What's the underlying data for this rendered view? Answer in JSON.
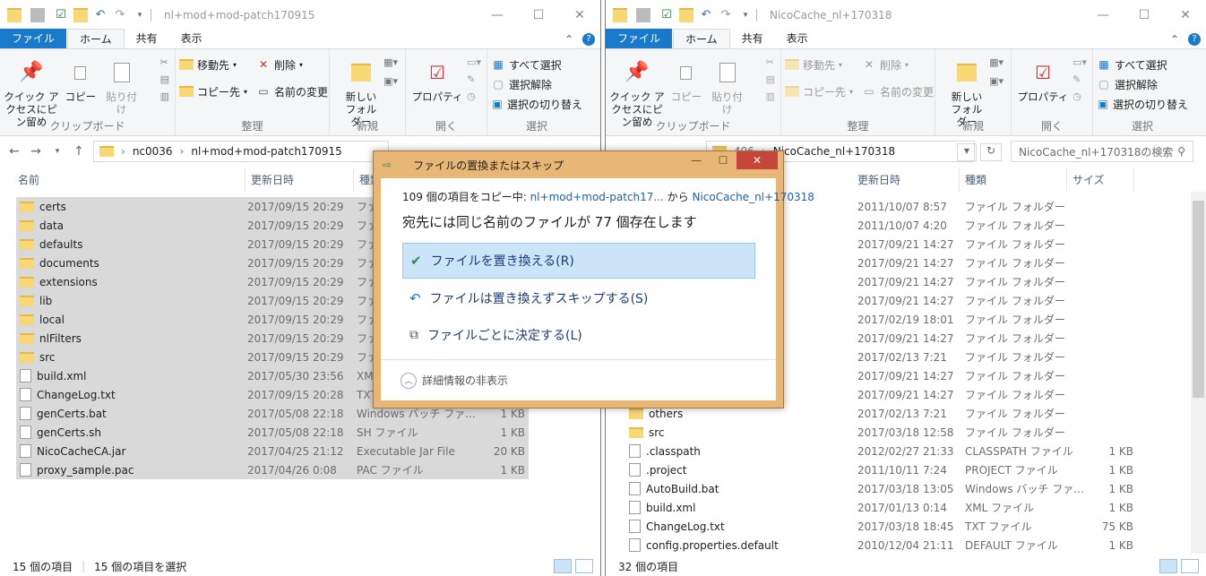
{
  "left": {
    "title": "nl+mod+mod-patch170915",
    "tabs": [
      "ファイル",
      "ホーム",
      "共有",
      "表示"
    ],
    "ribbon": {
      "pin": "クイック アクセスにピン留め",
      "copy": "コピー",
      "paste": "貼り付け",
      "clipboard": "クリップボード",
      "move_to": "移動先",
      "copy_to": "コピー先",
      "delete": "削除",
      "rename": "名前の変更",
      "organize": "整理",
      "new_folder": "新しいフォルダー",
      "new": "新規",
      "properties": "プロパティ",
      "open": "開く",
      "select_all": "すべて選択",
      "select_none": "選択解除",
      "invert": "選択の切り替え",
      "select": "選択"
    },
    "address": [
      "nc0036",
      "nl+mod+mod-patch170915"
    ],
    "columns": [
      "名前",
      "更新日時",
      "種類"
    ],
    "files": [
      {
        "name": "certs",
        "date": "2017/09/15 20:29",
        "type": "ファ",
        "size": "",
        "kind": "folder"
      },
      {
        "name": "data",
        "date": "2017/09/15 20:29",
        "type": "ファ",
        "size": "",
        "kind": "folder"
      },
      {
        "name": "defaults",
        "date": "2017/09/15 20:29",
        "type": "ファ",
        "size": "",
        "kind": "folder"
      },
      {
        "name": "documents",
        "date": "2017/09/15 20:29",
        "type": "ファ",
        "size": "",
        "kind": "folder"
      },
      {
        "name": "extensions",
        "date": "2017/09/15 20:29",
        "type": "ファ",
        "size": "",
        "kind": "folder"
      },
      {
        "name": "lib",
        "date": "2017/09/15 20:29",
        "type": "ファ",
        "size": "",
        "kind": "folder"
      },
      {
        "name": "local",
        "date": "2017/09/15 20:29",
        "type": "ファ",
        "size": "",
        "kind": "folder"
      },
      {
        "name": "nlFilters",
        "date": "2017/09/15 20:29",
        "type": "ファ",
        "size": "",
        "kind": "folder"
      },
      {
        "name": "src",
        "date": "2017/09/15 20:29",
        "type": "ファ",
        "size": "",
        "kind": "folder"
      },
      {
        "name": "build.xml",
        "date": "2017/05/30 23:56",
        "type": "XM",
        "size": "",
        "kind": "file"
      },
      {
        "name": "ChangeLog.txt",
        "date": "2017/09/15 20:28",
        "type": "TXT",
        "size": "",
        "kind": "file"
      },
      {
        "name": "genCerts.bat",
        "date": "2017/05/08 22:18",
        "type": "Windows バッチ ファ...",
        "size": "1 KB",
        "kind": "file"
      },
      {
        "name": "genCerts.sh",
        "date": "2017/05/08 22:18",
        "type": "SH ファイル",
        "size": "1 KB",
        "kind": "file"
      },
      {
        "name": "NicoCacheCA.jar",
        "date": "2017/04/25 21:12",
        "type": "Executable Jar File",
        "size": "20 KB",
        "kind": "file"
      },
      {
        "name": "proxy_sample.pac",
        "date": "2017/04/26 0:08",
        "type": "PAC ファイル",
        "size": "1 KB",
        "kind": "file"
      }
    ],
    "status_count": "15 個の項目",
    "status_selected": "15 個の項目を選択"
  },
  "right": {
    "title": "NicoCache_nl+170318",
    "tabs": [
      "ファイル",
      "ホーム",
      "共有",
      "表示"
    ],
    "address_prefix": "496",
    "address_current": "NicoCache_nl+170318",
    "search_placeholder": "NicoCache_nl+170318の検索",
    "columns": [
      "更新日時",
      "種類",
      "サイズ"
    ],
    "files": [
      {
        "name": "",
        "date": "2011/10/07 8:57",
        "type": "ファイル フォルダー",
        "size": "",
        "kind": "folder"
      },
      {
        "name": "",
        "date": "2011/10/07 4:20",
        "type": "ファイル フォルダー",
        "size": "",
        "kind": "folder"
      },
      {
        "name": "",
        "date": "2017/09/21 14:27",
        "type": "ファイル フォルダー",
        "size": "",
        "kind": "folder"
      },
      {
        "name": "",
        "date": "2017/09/21 14:27",
        "type": "ファイル フォルダー",
        "size": "",
        "kind": "folder"
      },
      {
        "name": "",
        "date": "2017/09/21 14:27",
        "type": "ファイル フォルダー",
        "size": "",
        "kind": "folder"
      },
      {
        "name": "",
        "date": "2017/09/21 14:27",
        "type": "ファイル フォルダー",
        "size": "",
        "kind": "folder"
      },
      {
        "name": "",
        "date": "2017/02/19 18:01",
        "type": "ファイル フォルダー",
        "size": "",
        "kind": "folder"
      },
      {
        "name": "",
        "date": "2017/09/21 14:27",
        "type": "ファイル フォルダー",
        "size": "",
        "kind": "folder"
      },
      {
        "name": "",
        "date": "2017/02/13 7:21",
        "type": "ファイル フォルダー",
        "size": "",
        "kind": "folder"
      },
      {
        "name": "",
        "date": "2017/09/21 14:27",
        "type": "ファイル フォルダー",
        "size": "",
        "kind": "folder"
      },
      {
        "name": "",
        "date": "2017/09/21 14:27",
        "type": "ファイル フォルダー",
        "size": "",
        "kind": "folder"
      },
      {
        "name": "others",
        "date": "2017/02/13 7:21",
        "type": "ファイル フォルダー",
        "size": "",
        "kind": "folder"
      },
      {
        "name": "src",
        "date": "2017/03/18 12:58",
        "type": "ファイル フォルダー",
        "size": "",
        "kind": "folder"
      },
      {
        "name": ".classpath",
        "date": "2012/02/27 21:33",
        "type": "CLASSPATH ファイル",
        "size": "1 KB",
        "kind": "file"
      },
      {
        "name": ".project",
        "date": "2011/10/11 7:24",
        "type": "PROJECT ファイル",
        "size": "1 KB",
        "kind": "file"
      },
      {
        "name": "AutoBuild.bat",
        "date": "2017/03/18 13:05",
        "type": "Windows バッチ ファ...",
        "size": "1 KB",
        "kind": "file"
      },
      {
        "name": "build.xml",
        "date": "2017/01/13 0:14",
        "type": "XML ファイル",
        "size": "1 KB",
        "kind": "file"
      },
      {
        "name": "ChangeLog.txt",
        "date": "2017/03/18 18:45",
        "type": "TXT ファイル",
        "size": "75 KB",
        "kind": "file"
      },
      {
        "name": "config.properties.default",
        "date": "2010/12/04 21:11",
        "type": "DEFAULT ファイル",
        "size": "1 KB",
        "kind": "file"
      }
    ],
    "status_count": "32 個の項目"
  },
  "dialog": {
    "title": "ファイルの置換またはスキップ",
    "line1_prefix": "109 個の項目をコピー中: ",
    "line1_src": "nl+mod+mod-patch17...",
    "line1_mid": " から ",
    "line1_dst": "NicoCache_nl+170318",
    "line2": "宛先には同じ名前のファイルが 77 個存在します",
    "opt_replace": "ファイルを置き換える(R)",
    "opt_skip": "ファイルは置き換えずスキップする(S)",
    "opt_decide": "ファイルごとに決定する(L)",
    "details": "詳細情報の非表示"
  }
}
